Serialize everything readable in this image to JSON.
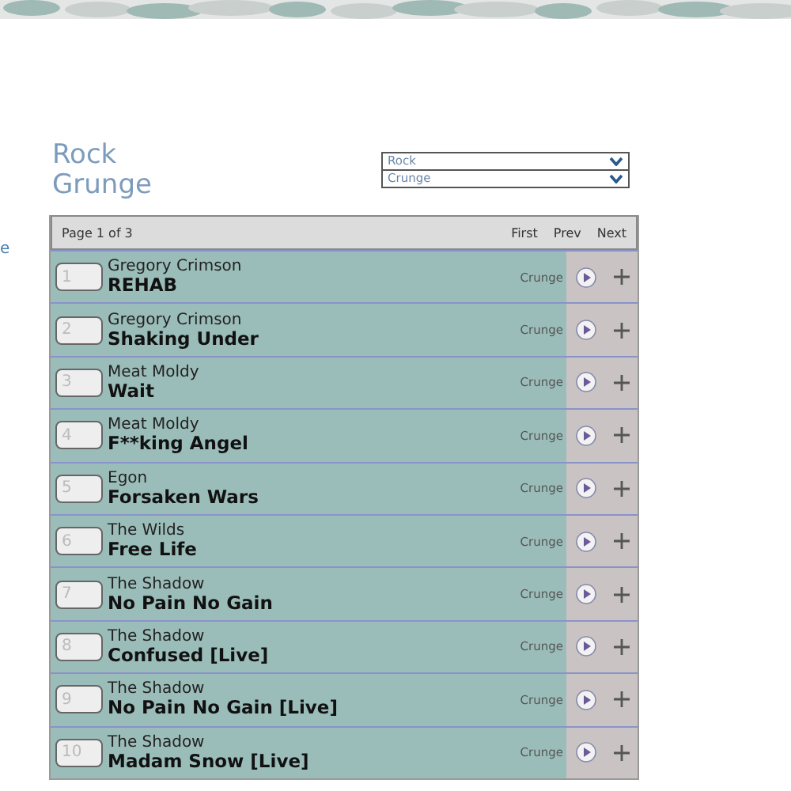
{
  "side_fragment": "e",
  "heading": {
    "lines": [
      "Rock",
      "Grunge"
    ]
  },
  "dropdowns": [
    {
      "value": "Rock"
    },
    {
      "value": "Crunge"
    }
  ],
  "pager": {
    "label": "Page 1 of 3",
    "links": [
      "First",
      "Prev",
      "Next"
    ]
  },
  "tracks": [
    {
      "number": "1",
      "artist": "Gregory Crimson",
      "title": "REHAB",
      "genre": "Crunge"
    },
    {
      "number": "2",
      "artist": "Gregory Crimson",
      "title": "Shaking Under",
      "genre": "Crunge"
    },
    {
      "number": "3",
      "artist": "Meat Moldy",
      "title": "Wait",
      "genre": "Crunge"
    },
    {
      "number": "4",
      "artist": "Meat Moldy",
      "title": "F**king Angel",
      "genre": "Crunge"
    },
    {
      "number": "5",
      "artist": "Egon",
      "title": "Forsaken Wars",
      "genre": "Crunge"
    },
    {
      "number": "6",
      "artist": "The Wilds",
      "title": "Free Life",
      "genre": "Crunge"
    },
    {
      "number": "7",
      "artist": "The Shadow",
      "title": "No Pain No Gain",
      "genre": "Crunge"
    },
    {
      "number": "8",
      "artist": "The Shadow",
      "title": "Confused [Live]",
      "genre": "Crunge"
    },
    {
      "number": "9",
      "artist": "The Shadow",
      "title": "No Pain No Gain [Live]",
      "genre": "Crunge"
    },
    {
      "number": "10",
      "artist": "The Shadow",
      "title": "Madam Snow [Live]",
      "genre": "Crunge"
    }
  ]
}
